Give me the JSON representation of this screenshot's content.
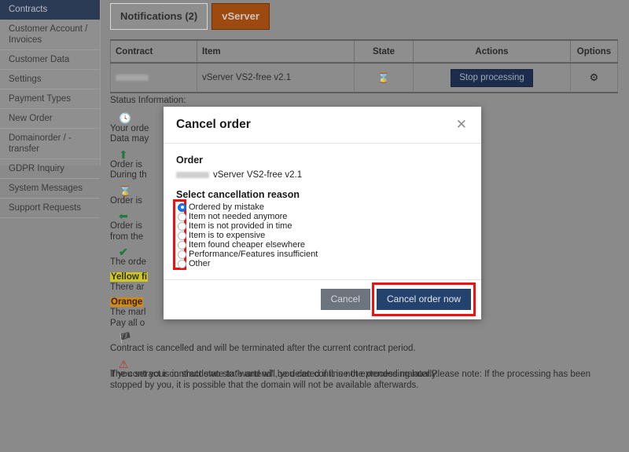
{
  "sidebar": {
    "items": [
      {
        "label": "Contracts",
        "active": true
      },
      {
        "label": "Customer Account / Invoices",
        "active": false
      },
      {
        "label": "Customer Data",
        "active": false
      },
      {
        "label": "Settings",
        "active": false
      },
      {
        "label": "Payment Types",
        "active": false
      },
      {
        "label": "New Order",
        "active": false
      },
      {
        "label": "Domainorder / -transfer",
        "active": false
      },
      {
        "label": "GDPR Inquiry",
        "active": false
      },
      {
        "label": "System Messages",
        "active": false
      },
      {
        "label": "Support Requests",
        "active": false
      }
    ]
  },
  "tabs": [
    {
      "label": "Notifications (2)",
      "active": false
    },
    {
      "label": "vServer",
      "active": true
    }
  ],
  "table": {
    "headers": [
      "Contract",
      "Item",
      "State",
      "Actions",
      "Options"
    ],
    "rows": [
      {
        "contract": "",
        "item": "vServer VS2-free v2.1",
        "state_icon": "hourglass-icon",
        "action_label": "Stop processing",
        "options_icon": "gear-icon"
      }
    ]
  },
  "status_info": {
    "title": "Status Information:",
    "entries": [
      {
        "icon": "clock-icon",
        "line1": "Your orde",
        "line2": "Data may"
      },
      {
        "icon": "arrow-up-icon",
        "line1": "Order is",
        "line2": "During th"
      },
      {
        "icon": "hourglass-icon",
        "line1": "Order is",
        "line2": ""
      },
      {
        "icon": "arrow-left-icon",
        "line1": "Order is",
        "line2": "from the"
      },
      {
        "icon": "checkmark-icon",
        "line1": "The orde",
        "line2": ""
      },
      {
        "icon": "yellow-marker",
        "line1": "Yellow fi",
        "line2": "There ar"
      },
      {
        "icon": "orange-marker",
        "line1": "Orange",
        "line2": "The marl",
        "line3": "Pay all o"
      },
      {
        "icon": "red-flag-icon",
        "line1": "Contract is cancelled and will be terminated after the current contract period.",
        "line2": ""
      },
      {
        "icon": "warning-triangle-icon",
        "line1": "The contract is in shutdown state and will be deleted if it is not extended manually.",
        "line2": ""
      }
    ],
    "footer_note": "If you set your contract state to \"wartend\", you can continue the processing later.Please note: If the processing has been stopped by you, it is possible that the domain will not be available afterwards."
  },
  "modal": {
    "title": "Cancel order",
    "close_icon": "close-icon",
    "order_heading": "Order",
    "order_item": "vServer VS2-free v2.1",
    "reason_heading": "Select cancellation reason",
    "reasons": [
      {
        "label": "Ordered by mistake",
        "selected": true
      },
      {
        "label": "Item not needed anymore",
        "selected": false
      },
      {
        "label": "Item is not provided in time",
        "selected": false
      },
      {
        "label": "Item is to expensive",
        "selected": false
      },
      {
        "label": "Item found cheaper elsewhere",
        "selected": false
      },
      {
        "label": "Performance/Features insufficient",
        "selected": false
      },
      {
        "label": "Other",
        "selected": false
      }
    ],
    "cancel_label": "Cancel",
    "confirm_label": "Cancel order now"
  },
  "colors": {
    "accent_tab": "#9c4a10",
    "sidebar_active": "#2b3a55",
    "primary_button": "#24426e",
    "secondary_button": "#6c757d",
    "radio_selected": "#1a73e8",
    "annotation": "#ee1111",
    "page_dim": "#8a8a8a"
  }
}
